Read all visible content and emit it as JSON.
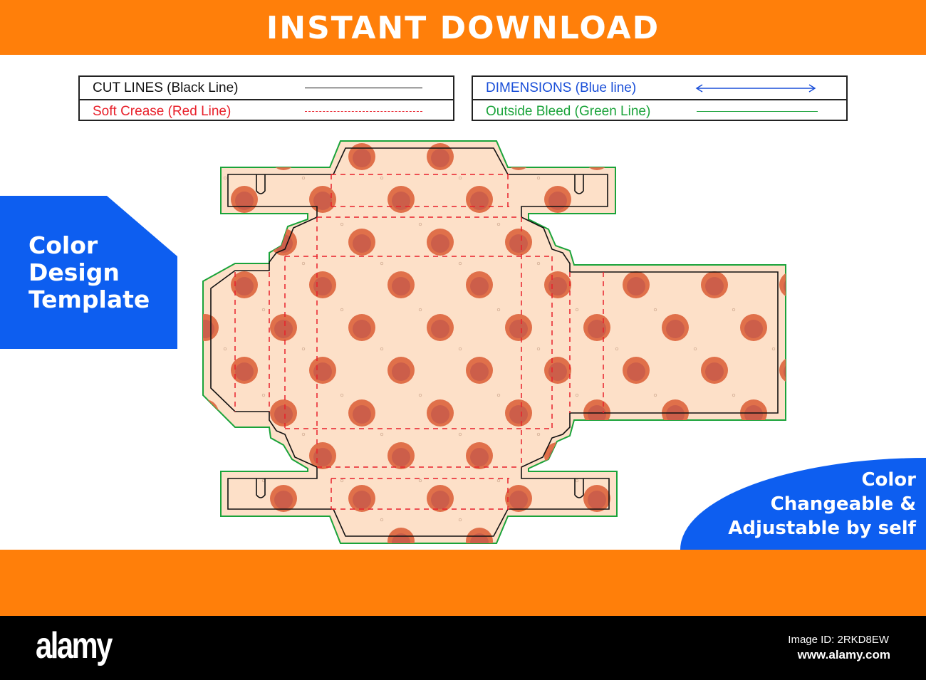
{
  "header": {
    "title": "INSTANT DOWNLOAD"
  },
  "legend": {
    "cut": "CUT LINES (Black Line)",
    "crease": "Soft Crease (Red Line)",
    "dimensions": "DIMENSIONS (Blue line)",
    "bleed": "Outside Bleed (Green Line)"
  },
  "colors": {
    "orange": "#ff7f0a",
    "blue": "#0d5ef0",
    "cut": "#111111",
    "crease": "#e8202a",
    "dimension": "#1a4fd8",
    "bleed": "#1aa33a",
    "fill": "#fde0c8",
    "dot": "#e0704a",
    "dot_inner": "#c4574a"
  },
  "left_badge": {
    "line1": "Color",
    "line2": "Design",
    "line3": "Template"
  },
  "right_badge": {
    "line1": "Color",
    "line2": "Changeable &",
    "line3": "Adjustable by self"
  },
  "footer": {
    "logo": "alamy",
    "image_id": "Image ID: 2RKD8EW",
    "url": "www.alamy.com"
  }
}
